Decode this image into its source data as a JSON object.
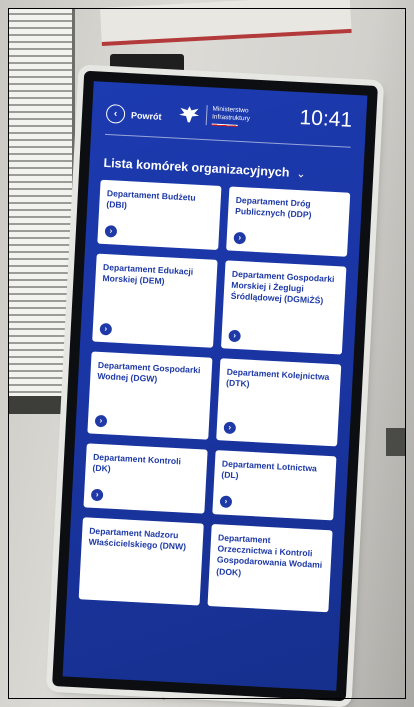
{
  "header": {
    "back_label": "Powrót",
    "logo_line1": "Ministerstwo",
    "logo_line2": "Infrastruktury",
    "clock": "10:41"
  },
  "section": {
    "title": "Lista komórek organizacyjnych"
  },
  "departments": [
    {
      "name": "Departament Budżetu (DBI)"
    },
    {
      "name": "Departament Dróg Publicznych (DDP)"
    },
    {
      "name": "Departament Edukacji Morskiej (DEM)"
    },
    {
      "name": "Departament Gospodarki Morskiej i Żeglugi Śródlądowej (DGMiŻŚ)"
    },
    {
      "name": "Departament Gospodarki Wodnej (DGW)"
    },
    {
      "name": "Departament Kolejnictwa (DTK)"
    },
    {
      "name": "Departament Kontroli (DK)"
    },
    {
      "name": "Departament Lotnictwa (DL)"
    },
    {
      "name": "Departament Nadzoru Właścicielskiego (DNW)"
    },
    {
      "name": "Departament Orzecznictwa i Kontroli Gospodarowania Wodami (DOK)"
    }
  ],
  "colors": {
    "screen_blue": "#1c3bb0",
    "tile_text": "#1f3aa6",
    "tile_bg": "#ffffff"
  }
}
